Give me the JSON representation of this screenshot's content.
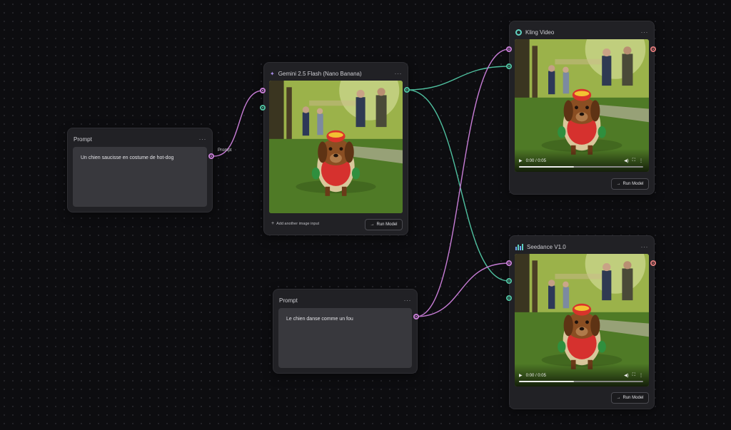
{
  "prompt_node_1": {
    "title": "Prompt",
    "text": "Un chien saucisse en costume de hot-dog"
  },
  "prompt_node_2": {
    "title": "Prompt",
    "text": "Le chien danse comme un fou"
  },
  "gemini_node": {
    "title": "Gemini 2.5 Flash (Nano Banana)",
    "add_image_label": "Add another image input",
    "run_label": "Run Model"
  },
  "kling_node": {
    "title": "Kling Video",
    "time": "0:00 / 0:05",
    "run_label": "Run Model"
  },
  "seedance_node": {
    "title": "Seedance V1.0",
    "time": "0:00 / 0:05",
    "run_label": "Run Model"
  },
  "edge_labels": {
    "prompt": "Prompt"
  },
  "menu_glyph": "···",
  "colors": {
    "text_port": "#c77dd6",
    "image_port": "#4fc1a0",
    "output_port": "#e07a7a"
  }
}
